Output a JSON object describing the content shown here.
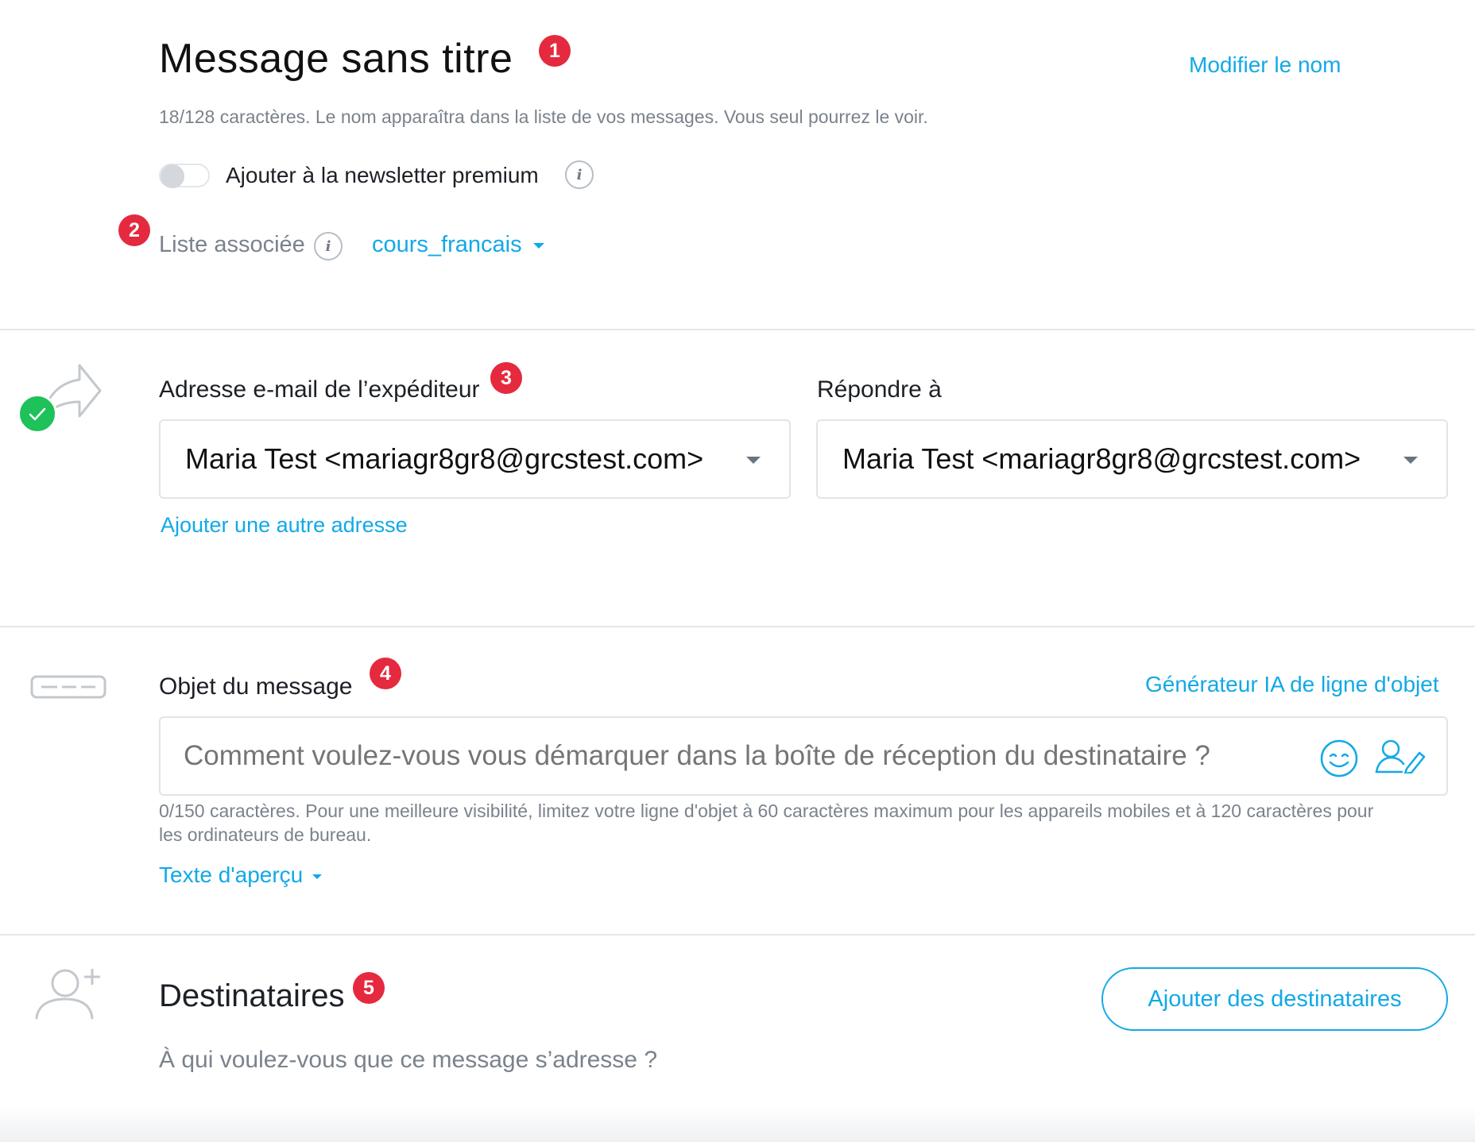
{
  "header": {
    "title": "Message sans titre",
    "rename_link": "Modifier le nom",
    "char_hint": "18/128 caractères. Le nom apparaîtra dans la liste de vos messages. Vous seul pourrez le voir.",
    "newsletter_toggle_label": "Ajouter à la newsletter premium",
    "list_label": "Liste associée",
    "list_value": "cours_francais"
  },
  "badges": [
    "1",
    "2",
    "3",
    "4",
    "5"
  ],
  "sender": {
    "from_label": "Adresse e-mail de l’expéditeur",
    "from_value": "Maria Test <mariagr8gr8@grcstest.com>",
    "reply_label": "Répondre à",
    "reply_value": "Maria Test <mariagr8gr8@grcstest.com>",
    "add_address_link": "Ajouter une autre adresse"
  },
  "subject": {
    "label": "Objet du message",
    "ai_link": "Générateur IA de ligne d'objet",
    "placeholder": "Comment voulez-vous vous démarquer dans la boîte de réception du destinataire ?",
    "value": "",
    "helper": "0/150 caractères. Pour une meilleure visibilité, limitez votre ligne d'objet à 60 caractères maximum pour les appareils mobiles et à 120 caractères pour les ordinateurs de bureau.",
    "preview_link": "Texte d'aperçu"
  },
  "recipients": {
    "title": "Destinataires",
    "subtitle": "À qui voulez-vous que ce message s’adresse ?",
    "add_button": "Ajouter des destinataires"
  },
  "colors": {
    "accent": "#12a9e6",
    "badge": "#e5293f",
    "success": "#1ec15a",
    "divider": "#e4e7ea"
  },
  "icons": [
    "info-icon",
    "forward-arrow-icon",
    "check-icon",
    "subject-line-icon",
    "emoji-icon",
    "personalize-icon",
    "add-user-icon",
    "chevron-down-icon"
  ]
}
